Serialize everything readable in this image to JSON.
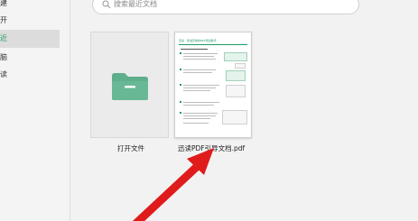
{
  "sidebar": {
    "items": [
      {
        "label": "建"
      },
      {
        "label": "开"
      },
      {
        "label": "近"
      },
      {
        "label": "脑"
      },
      {
        "label": "读"
      }
    ],
    "active_index": 2
  },
  "search": {
    "placeholder": "搜索最近文档"
  },
  "files": [
    {
      "label": "打开文件",
      "icon": "folder-icon"
    },
    {
      "label": "迅读PDF引导文档.pdf",
      "icon": "pdf-thumbnail"
    }
  ],
  "pdf_preview": {
    "title": "迅读 · 简洁高效的PDF阅读助手"
  },
  "colors": {
    "accent": "#1e9b62",
    "folder": "#5fae8c",
    "arrow": "#e01b1b"
  }
}
